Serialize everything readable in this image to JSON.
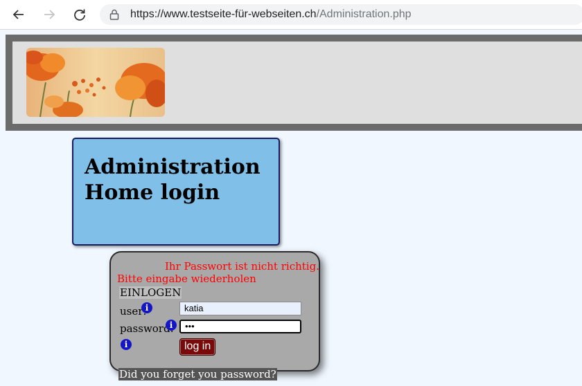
{
  "browser": {
    "url_domain": "https://www.testseite-für-webseiten.ch",
    "url_path": "/Administration.php",
    "icons": [
      "back-arrow-icon",
      "forward-arrow-icon",
      "reload-icon",
      "lock-icon"
    ]
  },
  "header": {
    "logo_name": "poppy-flowers-logo"
  },
  "title": {
    "line1": "Administration",
    "line2": "Home login"
  },
  "login": {
    "error_line1": "Ihr Passwort ist nicht richtig.",
    "error_line2": "Bitte eingabe wiederholen",
    "heading": "EINLOGEN",
    "user_label": "user:",
    "user_value": "katia",
    "password_label": "password:",
    "password_value": "•••",
    "button_label": "log in",
    "forgot_link": "Did you forget you password?"
  },
  "colors": {
    "page_bg": "#f0f7ff",
    "title_box": "#7fbfe8",
    "login_box": "#a9a9a9",
    "error_text": "#ff0000",
    "button": "#7a0a0a",
    "info_icon": "#1515c8"
  }
}
